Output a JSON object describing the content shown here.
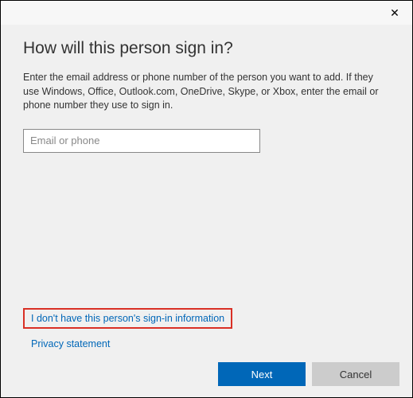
{
  "dialog": {
    "heading": "How will this person sign in?",
    "description": "Enter the email address or phone number of the person you want to add. If they use Windows, Office, Outlook.com, OneDrive, Skype, or Xbox, enter the email or phone number they use to sign in.",
    "input_placeholder": "Email or phone",
    "input_value": "",
    "link_no_info": "I don't have this person's sign-in information",
    "link_privacy": "Privacy statement",
    "btn_next": "Next",
    "btn_cancel": "Cancel"
  }
}
